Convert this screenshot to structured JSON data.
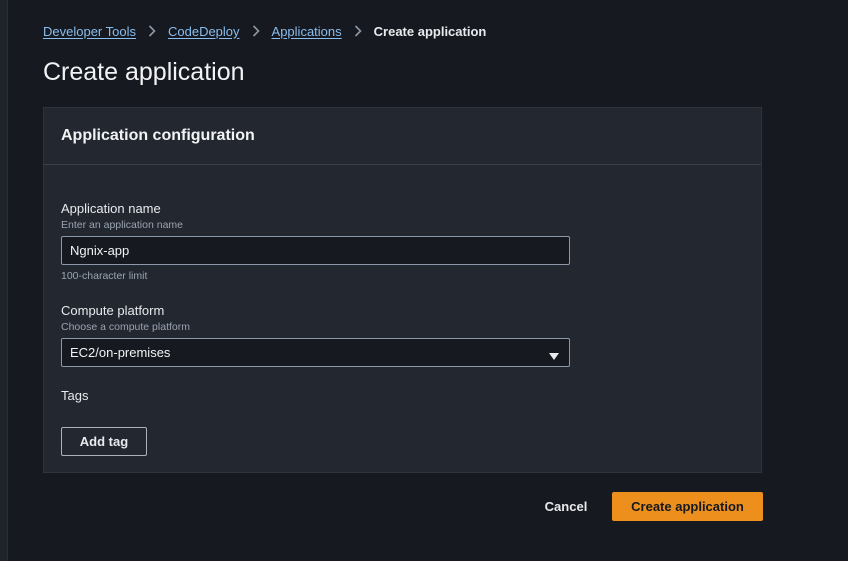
{
  "breadcrumb": {
    "items": [
      {
        "label": "Developer Tools"
      },
      {
        "label": "CodeDeploy"
      },
      {
        "label": "Applications"
      }
    ],
    "current": "Create application"
  },
  "page": {
    "title": "Create application"
  },
  "panel": {
    "title": "Application configuration",
    "app_name": {
      "label": "Application name",
      "description": "Enter an application name",
      "value": "Ngnix-app",
      "constraint": "100-character limit"
    },
    "compute_platform": {
      "label": "Compute platform",
      "description": "Choose a compute platform",
      "selected": "EC2/on-premises"
    },
    "tags": {
      "label": "Tags",
      "add_button": "Add tag"
    }
  },
  "actions": {
    "cancel": "Cancel",
    "submit": "Create application"
  },
  "icons": {
    "separator": "chevron-right-icon",
    "dropdown": "caret-down-icon"
  },
  "colors": {
    "background": "#16191f",
    "panel": "#232730",
    "link": "#89bdee",
    "primary": "#ec8f1d"
  }
}
